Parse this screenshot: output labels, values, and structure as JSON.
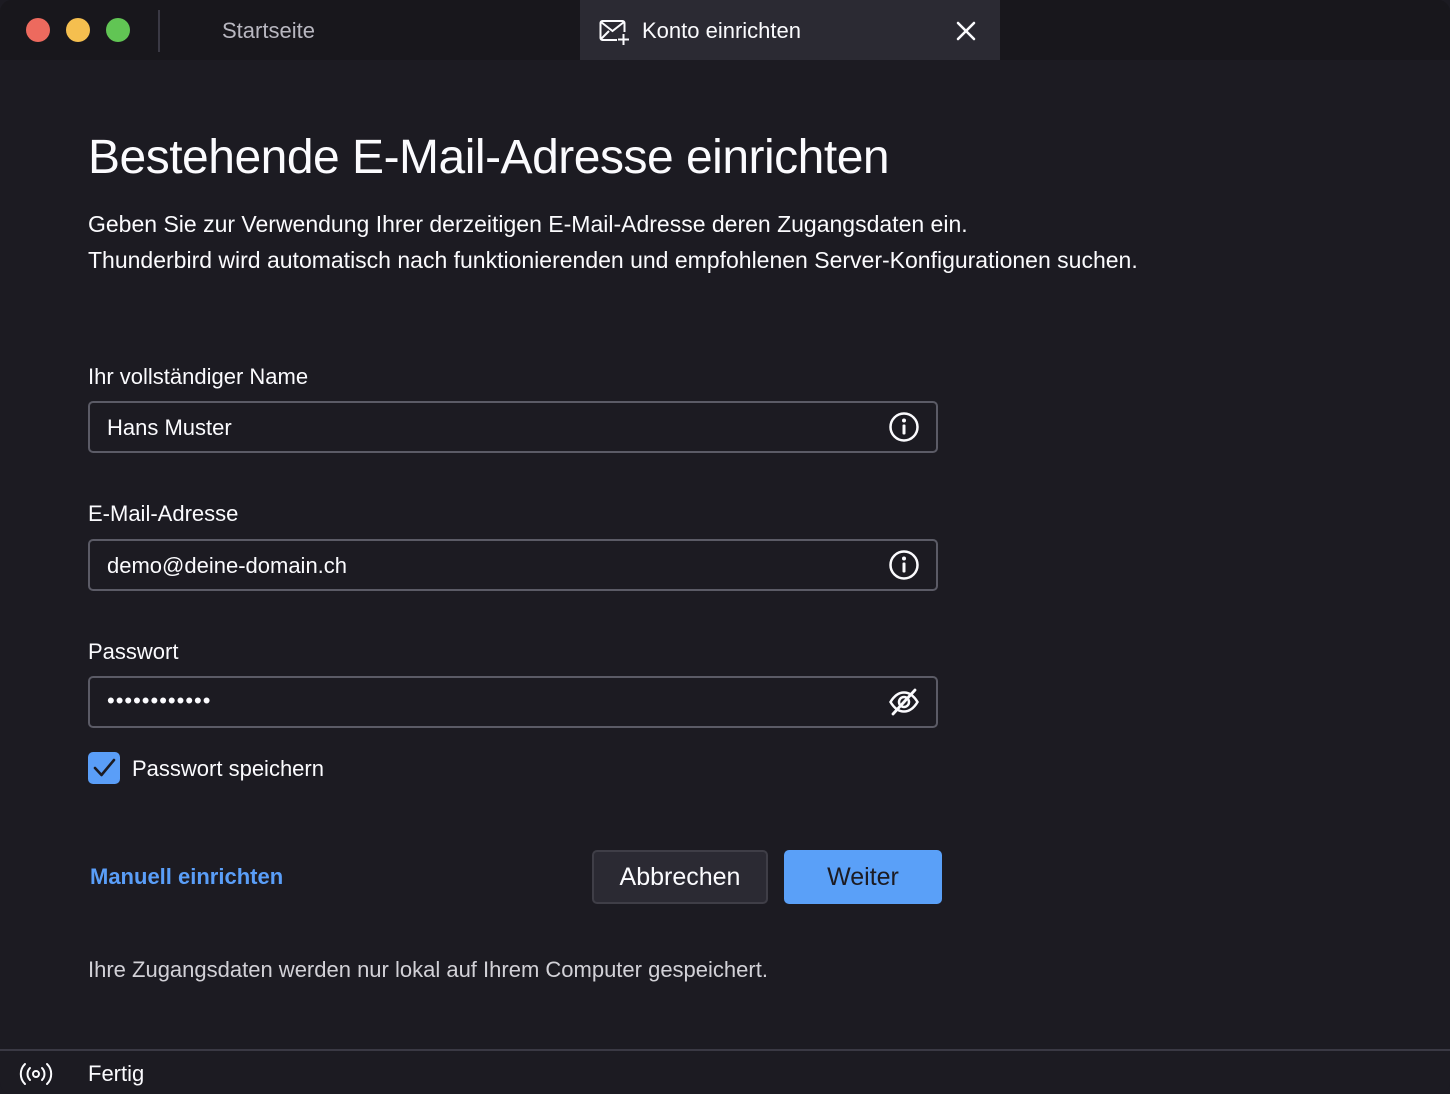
{
  "window": {
    "tabs": [
      {
        "label": "Startseite",
        "active": false
      },
      {
        "label": "Konto einrichten",
        "active": true,
        "icon": "mail-setup-icon"
      }
    ]
  },
  "page": {
    "title": "Bestehende E-Mail-Adresse einrichten",
    "intro_line1": "Geben Sie zur Verwendung Ihrer derzeitigen E-Mail-Adresse deren Zugangsdaten ein.",
    "intro_line2": "Thunderbird wird automatisch nach funktionierenden und empfohlenen Server-Konfigurationen suchen."
  },
  "form": {
    "name": {
      "label": "Ihr vollständiger Name",
      "value": "Hans Muster",
      "icon": "info-icon"
    },
    "email": {
      "label": "E-Mail-Adresse",
      "value": "demo@deine-domain.ch",
      "icon": "info-icon"
    },
    "password": {
      "label": "Passwort",
      "value": "••••••••••••",
      "icon": "eye-slash-icon"
    },
    "remember_password": {
      "label": "Passwort speichern",
      "checked": true
    }
  },
  "actions": {
    "manual_setup": "Manuell einrichten",
    "cancel": "Abbrechen",
    "next": "Weiter"
  },
  "footnote": "Ihre Zugangsdaten werden nur lokal auf Ihrem Computer gespeichert.",
  "statusbar": {
    "icon": "broadcast-icon",
    "text": "Fertig"
  },
  "colors": {
    "accent": "#5a9ef8",
    "background": "#1c1b22",
    "tab_active": "#2b2a33"
  }
}
